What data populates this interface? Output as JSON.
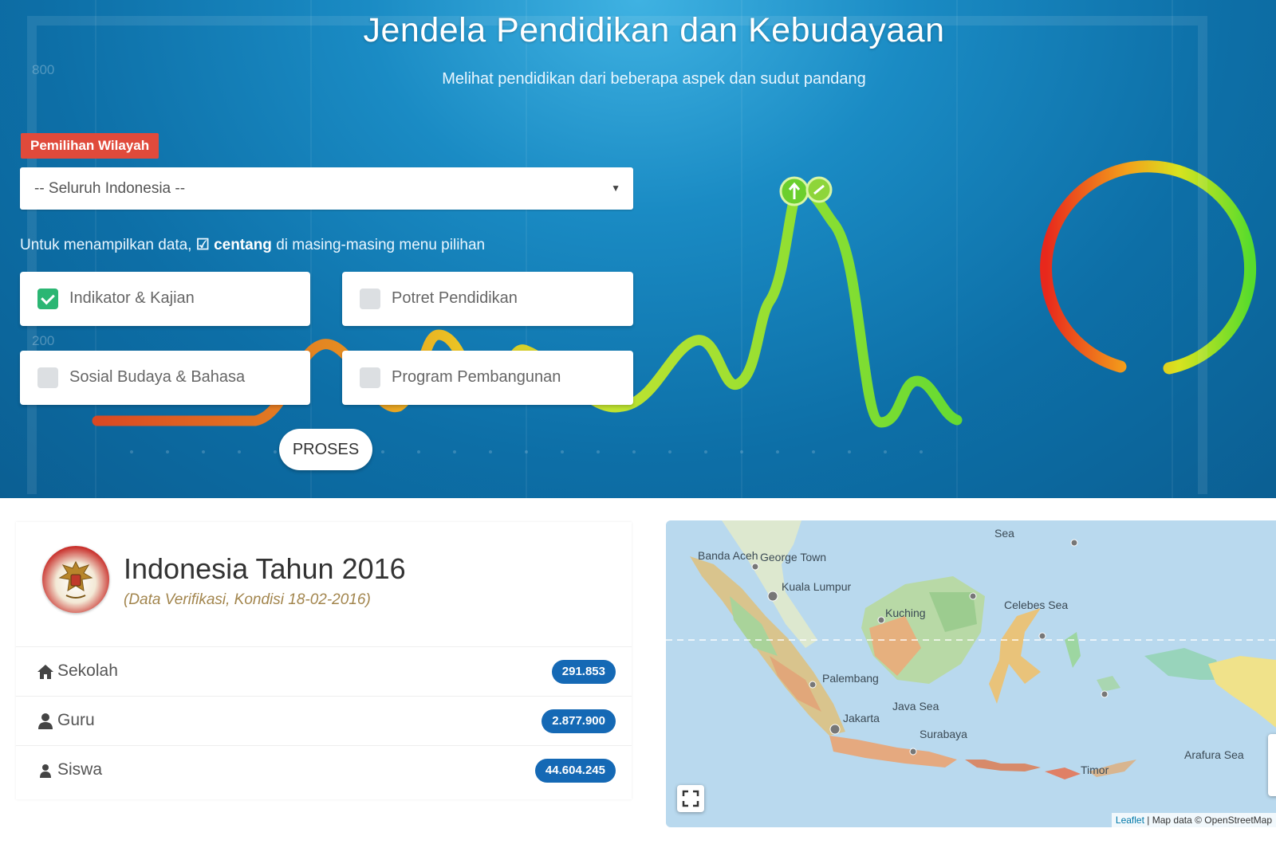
{
  "hero": {
    "title": "Jendela Pendidikan dan Kebudayaan",
    "subtitle": "Melihat pendidikan dari beberapa aspek dan sudut pandang",
    "bg_axis_labels": [
      "800",
      "200"
    ]
  },
  "region": {
    "badge": "Pemilihan Wilayah",
    "selected": "-- Seluruh Indonesia --",
    "caret_icon": "caret-down-icon"
  },
  "instruction": {
    "before": "Untuk menampilkan data,",
    "check_glyph": "☑",
    "bold": "centang",
    "after": "di masing-masing menu pilihan"
  },
  "options": [
    {
      "label": "Indikator & Kajian",
      "checked": true
    },
    {
      "label": "Potret Pendidikan",
      "checked": false
    },
    {
      "label": "Sosial Budaya & Bahasa",
      "checked": false
    },
    {
      "label": "Program Pembangunan",
      "checked": false
    }
  ],
  "process_button": "PROSES",
  "summary": {
    "title": "Indonesia Tahun 2016",
    "subtitle": "(Data Verifikasi, Kondisi 18-02-2016)",
    "rows": [
      {
        "icon": "home-icon",
        "label": "Sekolah",
        "value": "291.853"
      },
      {
        "icon": "user-icon",
        "label": "Guru",
        "value": "2.877.900"
      },
      {
        "icon": "user-icon",
        "label": "Siswa",
        "value": "44.604.245"
      }
    ]
  },
  "map": {
    "labels": [
      "Banda Aceh",
      "George Town",
      "Kuala Lumpur",
      "Palembang",
      "Jakarta",
      "Java Sea",
      "Surabaya",
      "Celebes Sea",
      "Arafura Sea",
      "Timor",
      "Kuching",
      "Sea"
    ],
    "attribution_link": "Leaflet",
    "attribution_text": "| Map data © OpenStreetMap"
  },
  "colors": {
    "badge": "#e04a3b",
    "checkbox_on": "#2bb673",
    "stat_badge": "#1569b5",
    "hero_blue": "#0d6fa7"
  }
}
